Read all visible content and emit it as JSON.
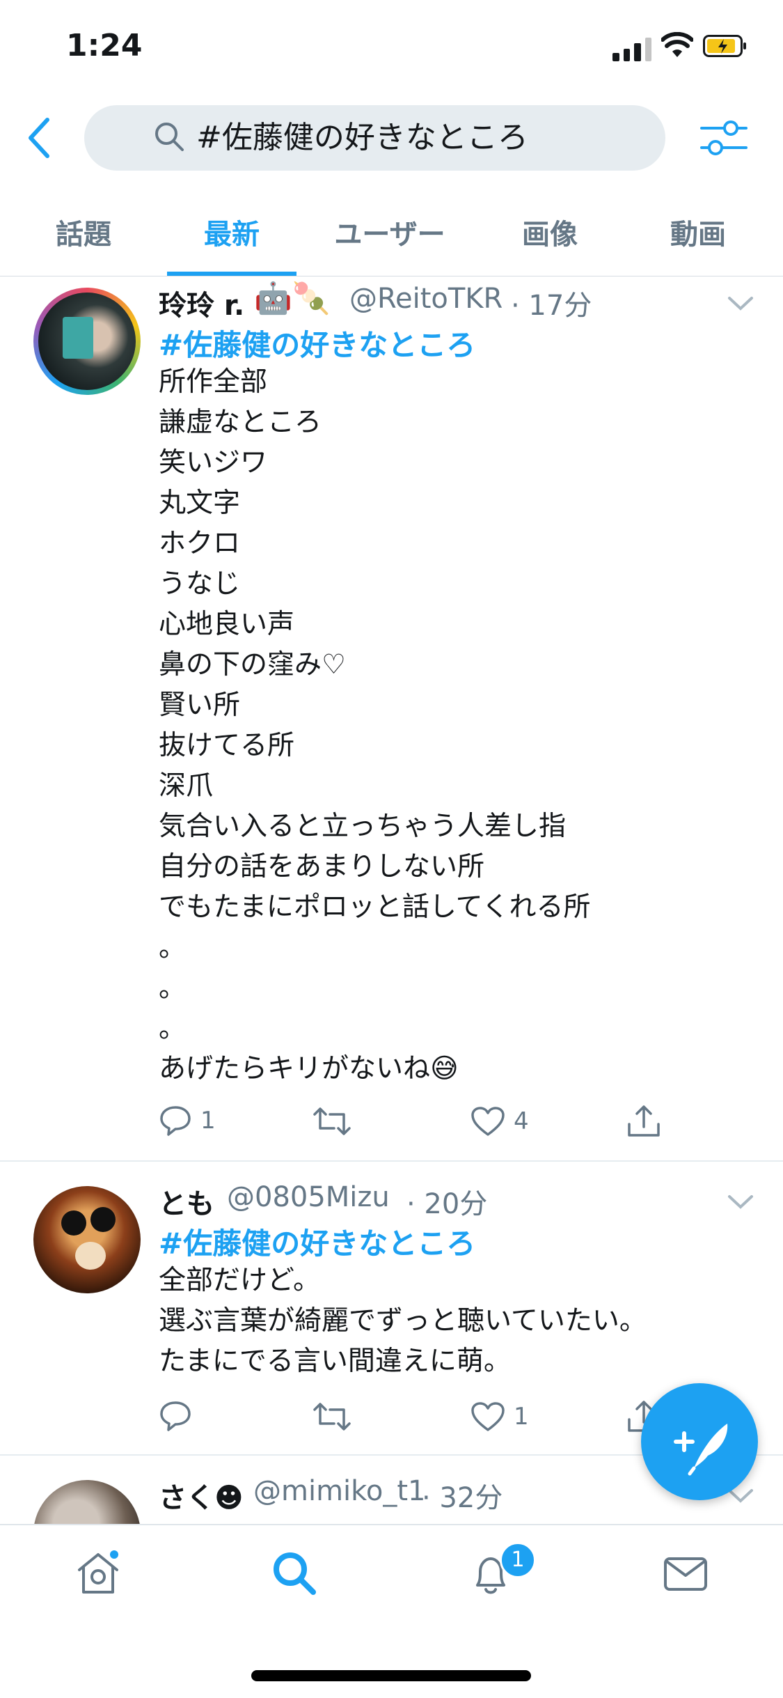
{
  "status": {
    "time": "1:24"
  },
  "search": {
    "query": "#佐藤健の好きなところ"
  },
  "tabs": [
    {
      "label": "話題"
    },
    {
      "label": "最新"
    },
    {
      "label": "ユーザー"
    },
    {
      "label": "画像"
    },
    {
      "label": "動画"
    }
  ],
  "active_tab": "最新",
  "tweets": [
    {
      "name": "玲玲 r.",
      "name_emoji": "🤖🍡",
      "handle": "@ReitoTKR",
      "time": "· 17分",
      "hashtag": "#佐藤健の好きなところ",
      "lines": [
        "所作全部",
        "謙虚なところ",
        "笑いジワ",
        "丸文字",
        "ホクロ",
        "うなじ",
        "心地良い声",
        "鼻の下の窪み♡",
        "賢い所",
        "抜けてる所",
        "深爪",
        "気合い入ると立っちゃう人差し指",
        "自分の話をあまりしない所",
        "でもたまにポロッと話してくれる所",
        "。",
        "。",
        "。",
        "あげたらキリがないね😅"
      ],
      "replies": "1",
      "retweets": "",
      "likes": "4"
    },
    {
      "name": "とも",
      "handle": "@0805Mizu",
      "time": "· 20分",
      "hashtag": "#佐藤健の好きなところ",
      "lines": [
        "全部だけど。",
        "選ぶ言葉が綺麗でずっと聴いていたい。",
        "たまにでる言い間違えに萌。"
      ],
      "replies": "",
      "retweets": "",
      "likes": "1"
    },
    {
      "name": "さく☻",
      "handle": "@mimiko_t1",
      "time": "· 32分"
    }
  ],
  "notifications_badge": "1",
  "colors": {
    "accent": "#1da1f2",
    "secondary_text": "#657786",
    "search_bg": "#e6ecf0"
  },
  "icons": [
    "back-icon",
    "search-icon",
    "filter-icon",
    "reply-icon",
    "retweet-icon",
    "like-icon",
    "share-icon",
    "compose-icon",
    "home-icon",
    "notifications-icon",
    "messages-icon"
  ]
}
